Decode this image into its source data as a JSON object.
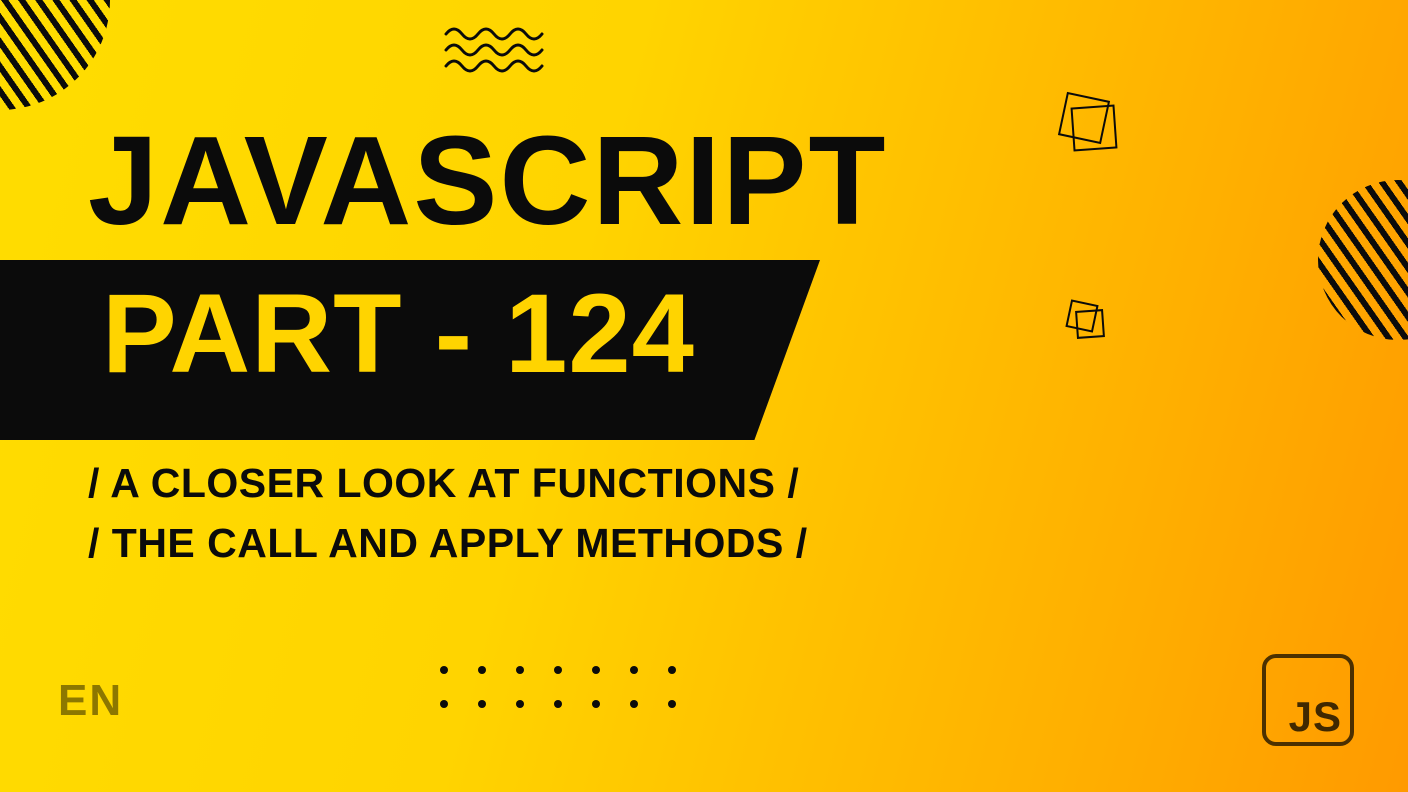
{
  "title": "JAVASCRIPT",
  "part_label": "PART - 124",
  "subtitle_line1": "/ A CLOSER LOOK AT FUNCTIONS /",
  "subtitle_line2": "/ THE CALL AND APPLY METHODS /",
  "language": "EN",
  "logo_text": "JS"
}
